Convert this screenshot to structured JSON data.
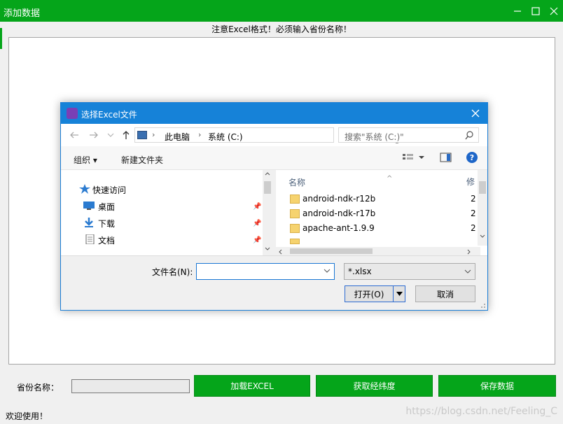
{
  "window": {
    "title": "添加数据",
    "notice": "注意Excel格式！必须输入省份名称！"
  },
  "dialog": {
    "title": "选择Excel文件",
    "breadcrumb": [
      "此电脑",
      "系统 (C:)"
    ],
    "search_placeholder": "搜索\"系统 (C:)\"",
    "toolbar": {
      "organize": "组织",
      "new_folder": "新建文件夹"
    },
    "nav_tree": [
      {
        "label": "快速访问",
        "icon": "star-icon"
      },
      {
        "label": "桌面",
        "icon": "desktop-icon",
        "pinned": true
      },
      {
        "label": "下载",
        "icon": "download-arrow-icon",
        "pinned": true
      },
      {
        "label": "文档",
        "icon": "document-icon",
        "pinned": true
      }
    ],
    "columns": {
      "name": "名称",
      "date": "修"
    },
    "files": [
      {
        "name": "android-ndk-r12b",
        "date": "2"
      },
      {
        "name": "android-ndk-r17b",
        "date": "2"
      },
      {
        "name": "apache-ant-1.9.9",
        "date": "2"
      }
    ],
    "filename_label": "文件名(N):",
    "filename_value": "",
    "filetype": "*.xlsx",
    "open_label": "打开(O)",
    "cancel_label": "取消"
  },
  "form": {
    "province_label": "省份名称：",
    "province_value": "",
    "buttons": [
      "加载EXCEL",
      "获取经纬度",
      "保存数据"
    ]
  },
  "status": "欢迎使用！",
  "watermark": "https://blog.csdn.net/Feeling_C",
  "colors": {
    "accent_green": "#05a51a",
    "dialog_blue": "#1682d8"
  }
}
